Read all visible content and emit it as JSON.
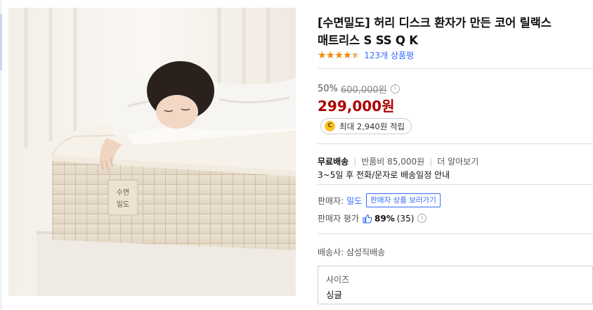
{
  "product": {
    "title": "[수면밀도] 허리 디스크 환자가 만든 코어 릴랙스 매트리스 S SS Q K",
    "rating": 4.5,
    "review_link": "123개 상품평",
    "image_tag_line1": "수면",
    "image_tag_line2": "밀도"
  },
  "price": {
    "discount_rate": "50%",
    "original": "600,000원",
    "sale": "299,000원",
    "info_glyph": "i"
  },
  "cash": {
    "coin_glyph": "C",
    "text": "최대 2,940원 적립"
  },
  "shipping": {
    "free": "무료배송",
    "return_fee": "반품비 85,000원",
    "more": "더 알아보기",
    "note": "3~5일 후 전화/문자로 배송일정 안내"
  },
  "seller": {
    "label": "판매자:",
    "name": "밀도",
    "button": "판매자 상품 보러가기",
    "eval_label": "판매자 평가",
    "eval_pct": "89%",
    "eval_count": "(35)"
  },
  "delivery": {
    "text": "배송사: 삼성직배송"
  },
  "option": {
    "label": "사이즈",
    "value": "싱글"
  },
  "colors": {
    "sale_price": "#ae0000",
    "link": "#346aff",
    "star": "#f28b00"
  }
}
